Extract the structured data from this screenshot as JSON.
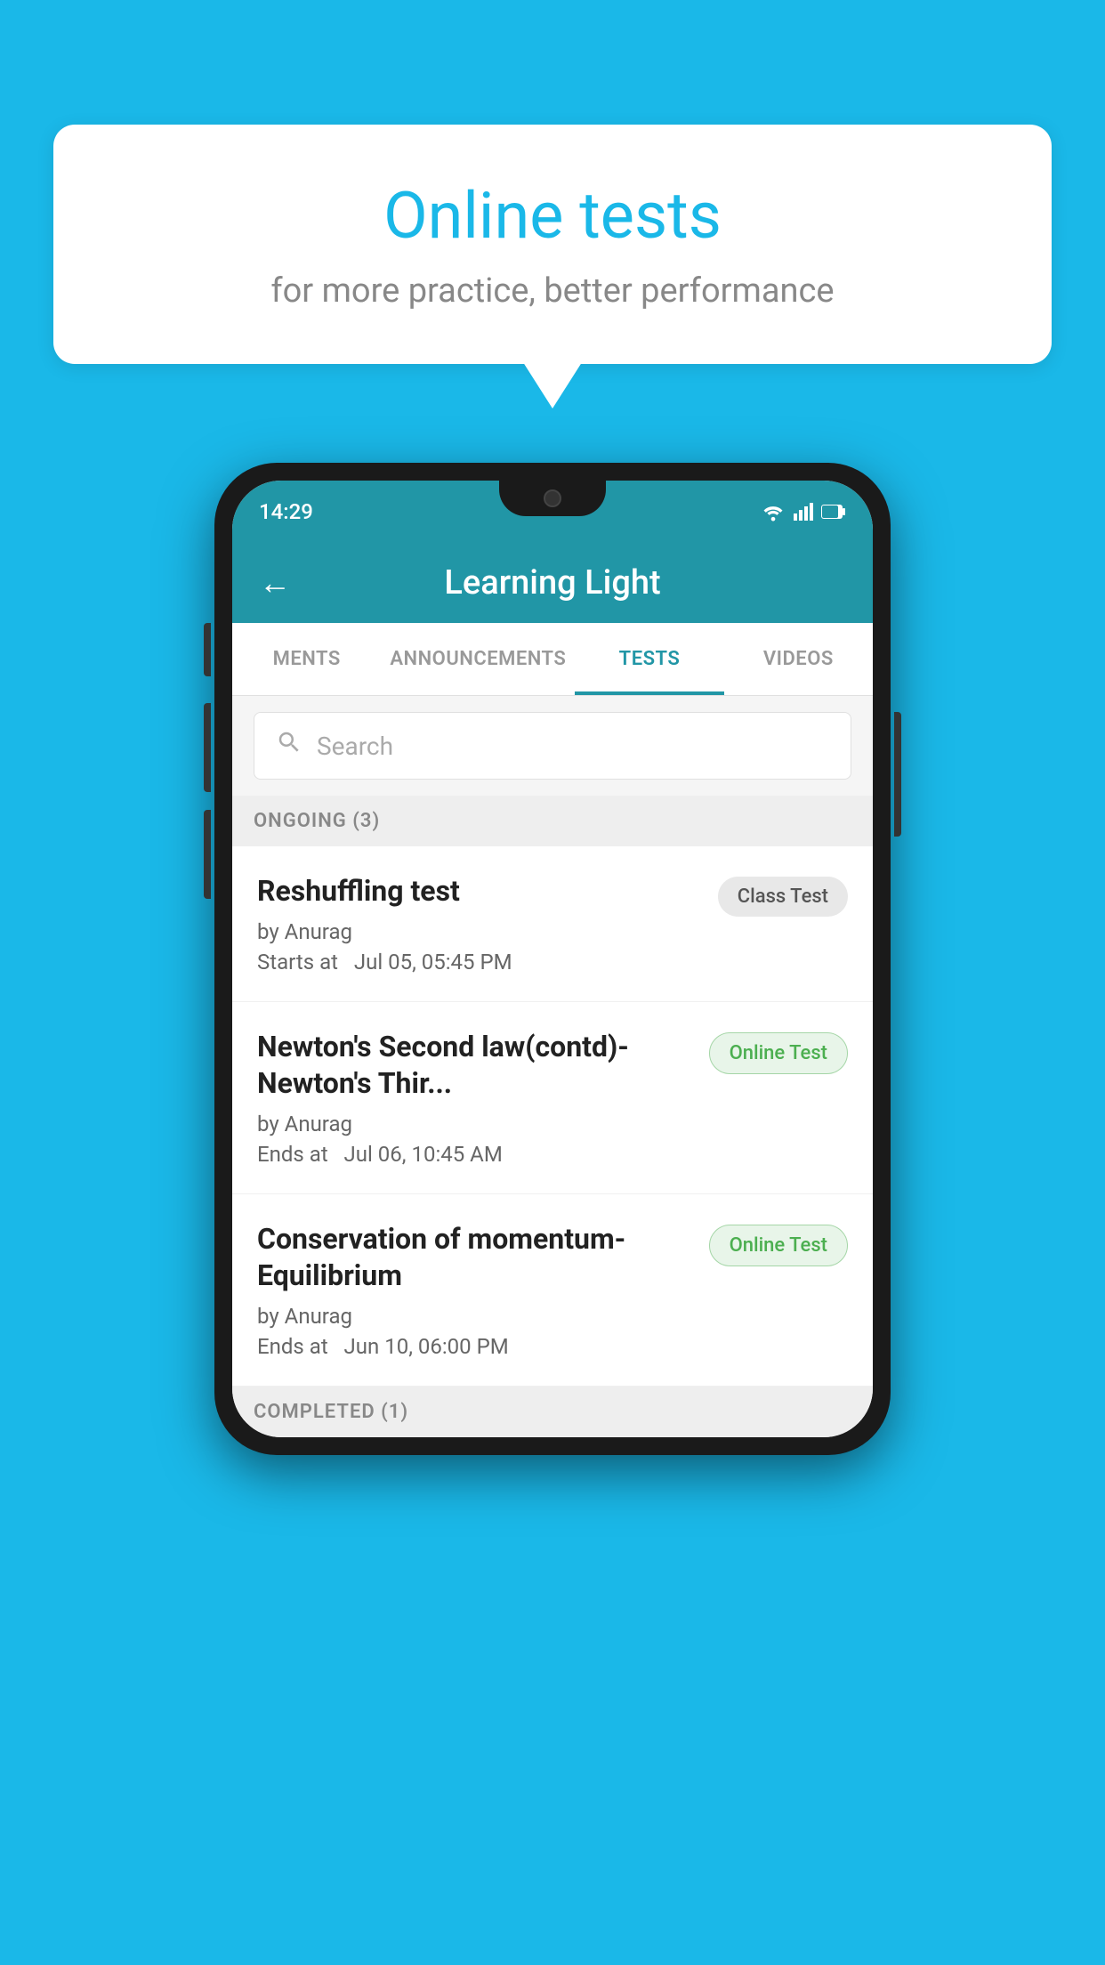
{
  "background_color": "#1ab8e8",
  "speech_bubble": {
    "title": "Online tests",
    "subtitle": "for more practice, better performance"
  },
  "phone": {
    "status_bar": {
      "time": "14:29",
      "icons": [
        "wifi",
        "signal",
        "battery"
      ]
    },
    "app_bar": {
      "back_label": "←",
      "title": "Learning Light"
    },
    "tabs": [
      {
        "label": "MENTS",
        "active": false
      },
      {
        "label": "ANNOUNCEMENTS",
        "active": false
      },
      {
        "label": "TESTS",
        "active": true
      },
      {
        "label": "VIDEOS",
        "active": false
      }
    ],
    "search": {
      "placeholder": "Search"
    },
    "sections": [
      {
        "header": "ONGOING (3)",
        "items": [
          {
            "title": "Reshuffling test",
            "author": "by Anurag",
            "time_label": "Starts at",
            "time": "Jul 05, 05:45 PM",
            "badge": "Class Test",
            "badge_type": "class"
          },
          {
            "title": "Newton's Second law(contd)-Newton's Thir...",
            "author": "by Anurag",
            "time_label": "Ends at",
            "time": "Jul 06, 10:45 AM",
            "badge": "Online Test",
            "badge_type": "online"
          },
          {
            "title": "Conservation of momentum-Equilibrium",
            "author": "by Anurag",
            "time_label": "Ends at",
            "time": "Jun 10, 06:00 PM",
            "badge": "Online Test",
            "badge_type": "online"
          }
        ]
      },
      {
        "header": "COMPLETED (1)",
        "items": []
      }
    ]
  }
}
